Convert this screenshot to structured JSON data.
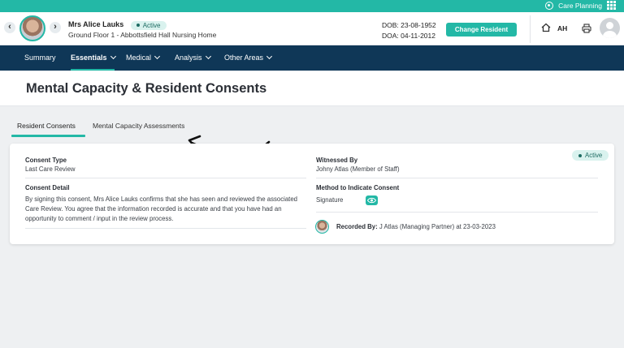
{
  "topbar": {
    "app_label": "Care Planning"
  },
  "resident": {
    "name": "Mrs Alice Lauks",
    "status": "Active",
    "location": "Ground Floor 1 - Abbottsfield Hall Nursing Home",
    "dob": "DOB: 23-08-1952",
    "doa": "DOA: 04-11-2012",
    "change_label": "Change Resident"
  },
  "user": {
    "initials": "AH"
  },
  "nav": {
    "items": [
      "Summary",
      "Essentials",
      "Medical",
      "Analysis",
      "Other Areas"
    ],
    "active": "Essentials"
  },
  "page": {
    "title": "Mental Capacity & Resident Consents"
  },
  "tabs": [
    "Resident Consents",
    "Mental Capacity Assessments"
  ],
  "consent": {
    "status": "Active",
    "type_label": "Consent Type",
    "type_value": "Last Care Review",
    "detail_label": "Consent Detail",
    "detail_value": "By signing this consent, Mrs Alice Lauks confirms that she has seen and reviewed the associated Care Review. You agree that the information recorded is accurate and that you have had an opportunity to comment / input in the review process.",
    "witness_label": "Witnessed By",
    "witness_value": "Johny Atlas (Member of Staff)",
    "method_label": "Method to Indicate Consent",
    "method_value": "Signature",
    "recorded_label": "Recorded By:",
    "recorded_value": "J Atlas (Managing Partner) at 23-03-2023"
  },
  "colors": {
    "accent": "#23b8a6",
    "nav_bg": "#0f3757"
  }
}
